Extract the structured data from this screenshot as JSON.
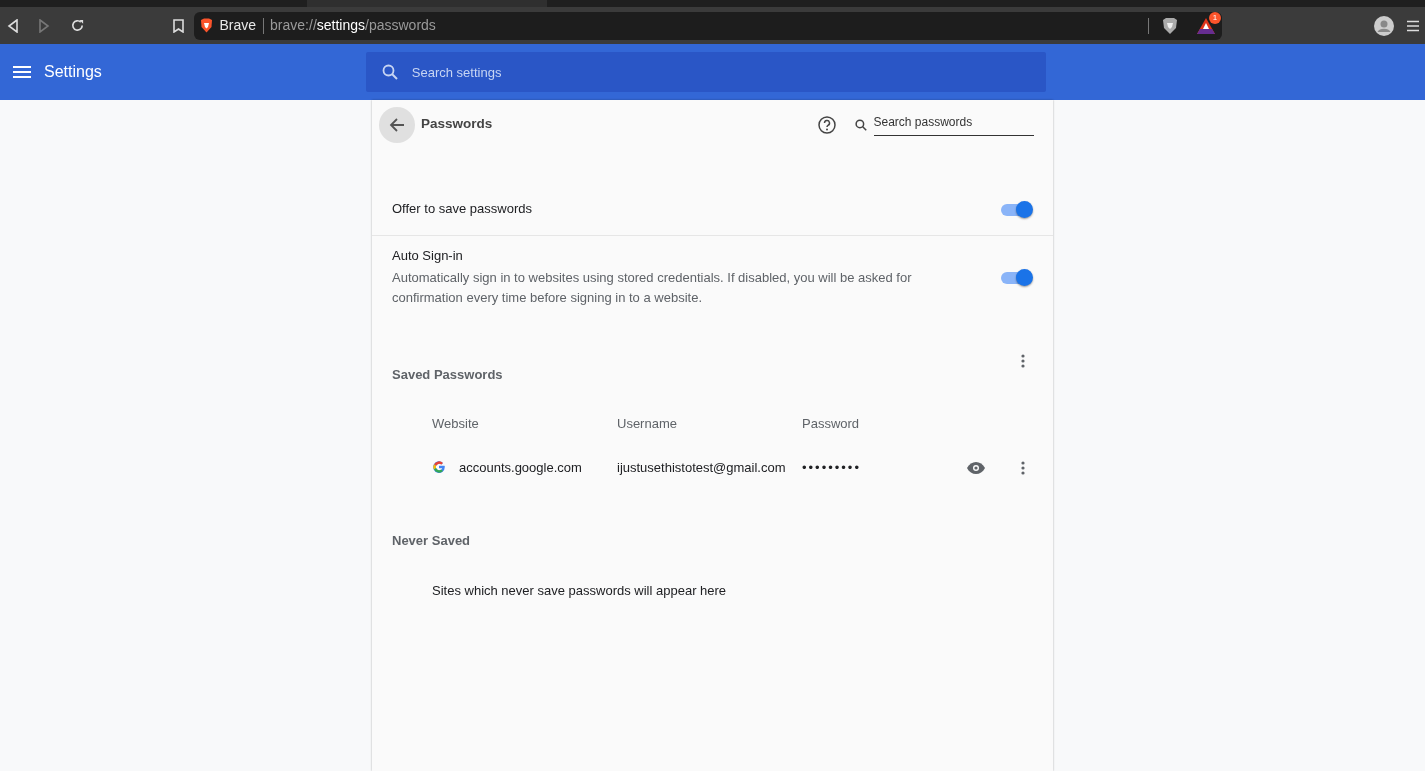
{
  "browser": {
    "site_label": "Brave",
    "url": "brave://**settings**/passwords",
    "rewards_badge": "1"
  },
  "header": {
    "title": "Settings",
    "search": {
      "placeholder": "Search settings"
    }
  },
  "page": {
    "title": "Passwords",
    "search": {
      "placeholder": "Search passwords"
    },
    "settings": [
      {
        "label": "Offer to save passwords",
        "on": true
      },
      {
        "label": "Auto Sign-in",
        "description": "Automatically sign in to websites using stored credentials. If disabled, you will be asked for confirmation every time before signing in to a website.",
        "on": true
      }
    ],
    "saved": {
      "title": "Saved Passwords",
      "columns": [
        "Website",
        "Username",
        "Password"
      ],
      "rows": [
        {
          "website": "accounts.google.com",
          "username": "ijustusethistotest@gmail.com",
          "password": "•••••••••"
        }
      ]
    },
    "never_saved": {
      "title": "Never Saved",
      "empty_text": "Sites which never save passwords will appear here"
    }
  }
}
